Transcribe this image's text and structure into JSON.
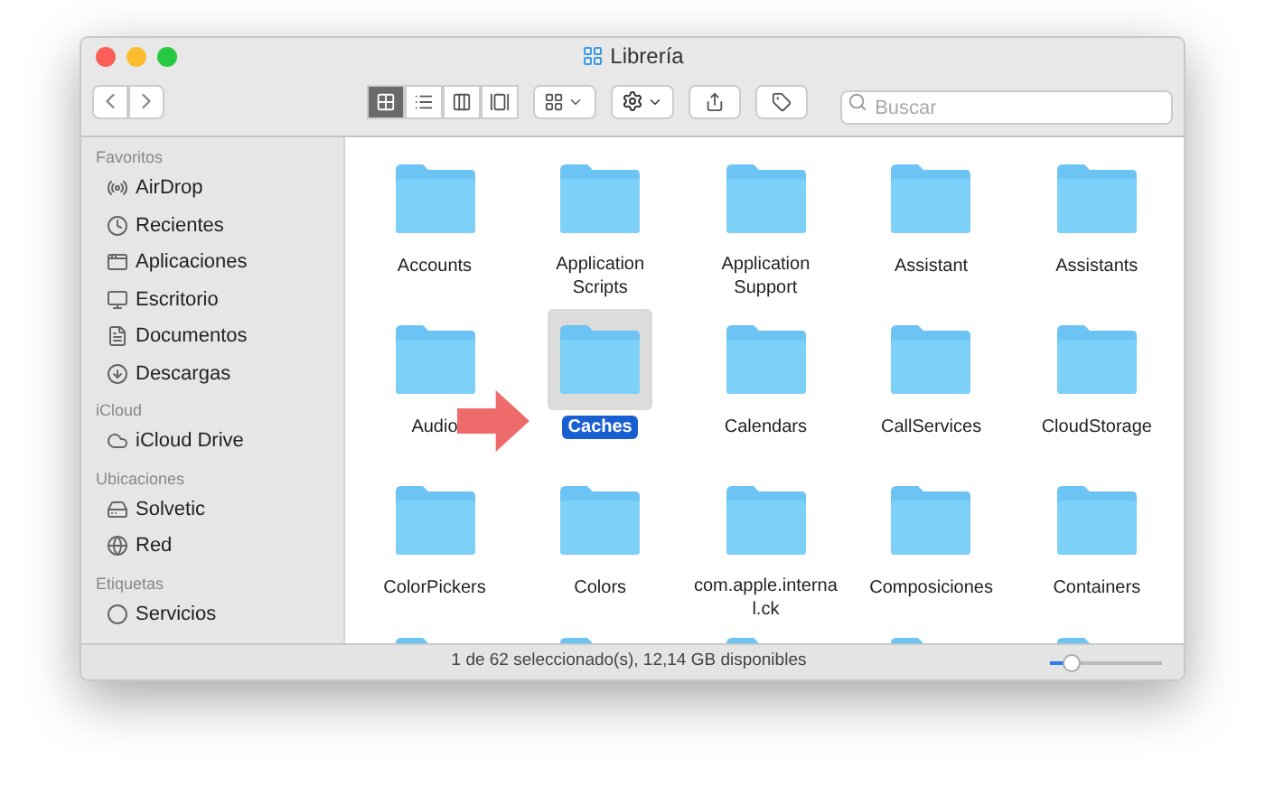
{
  "window": {
    "title": "Librería"
  },
  "toolbar": {
    "views": [
      {
        "kind": "icons",
        "selected": true
      },
      {
        "kind": "list",
        "selected": false
      },
      {
        "kind": "columns",
        "selected": false
      },
      {
        "kind": "gallery",
        "selected": false
      }
    ],
    "search": {
      "placeholder": "Buscar"
    }
  },
  "sidebar": {
    "sections": [
      {
        "title": "Favoritos",
        "items": [
          {
            "label": "AirDrop",
            "kind": "airdrop"
          },
          {
            "label": "Recientes",
            "kind": "recent"
          },
          {
            "label": "Aplicaciones",
            "kind": "apps"
          },
          {
            "label": "Escritorio",
            "kind": "desktop"
          },
          {
            "label": "Documentos",
            "kind": "docs"
          },
          {
            "label": "Descargas",
            "kind": "downloads"
          }
        ]
      },
      {
        "title": "iCloud",
        "items": [
          {
            "label": "iCloud Drive",
            "kind": "cloud"
          }
        ]
      },
      {
        "title": "Ubicaciones",
        "items": [
          {
            "label": "Solvetic",
            "kind": "disk"
          },
          {
            "label": "Red",
            "kind": "network"
          }
        ]
      },
      {
        "title": "Etiquetas",
        "items": [
          {
            "label": "Servicios",
            "kind": "tag"
          }
        ]
      }
    ]
  },
  "folders": [
    {
      "name": "Accounts",
      "selected": false
    },
    {
      "name": "Application Scripts",
      "selected": false
    },
    {
      "name": "Application Support",
      "selected": false
    },
    {
      "name": "Assistant",
      "selected": false
    },
    {
      "name": "Assistants",
      "selected": false
    },
    {
      "name": "Audio",
      "selected": false
    },
    {
      "name": "Caches",
      "selected": true
    },
    {
      "name": "Calendars",
      "selected": false
    },
    {
      "name": "CallServices",
      "selected": false
    },
    {
      "name": "CloudStorage",
      "selected": false
    },
    {
      "name": "ColorPickers",
      "selected": false
    },
    {
      "name": "Colors",
      "selected": false
    },
    {
      "name": "com.apple.interna l.ck",
      "selected": false
    },
    {
      "name": "Composiciones",
      "selected": false
    },
    {
      "name": "Containers",
      "selected": false
    }
  ],
  "status_bar": {
    "text": "1 de 62 seleccionado(s), 12,14 GB disponibles",
    "zoom": {
      "level": 0.2
    }
  }
}
